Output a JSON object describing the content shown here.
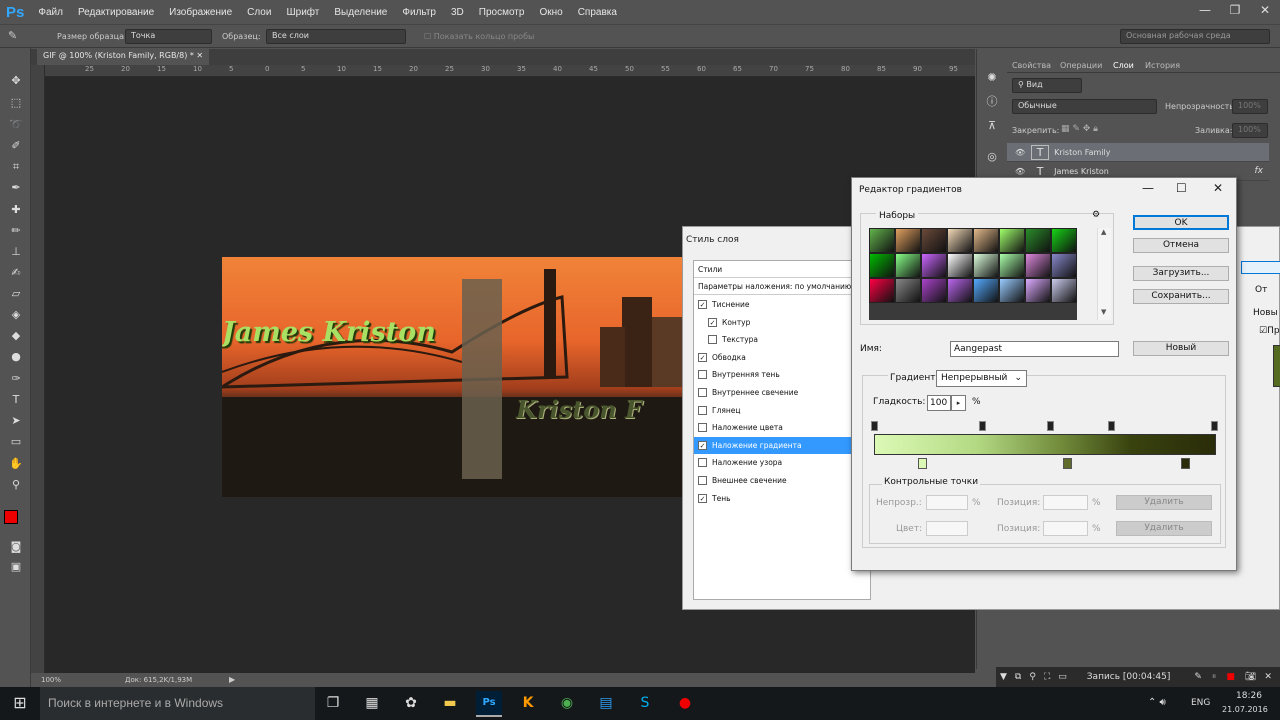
{
  "app": {
    "logo": "Ps"
  },
  "menu": [
    "Файл",
    "Редактирование",
    "Изображение",
    "Слои",
    "Шрифт",
    "Выделение",
    "Фильтр",
    "3D",
    "Просмотр",
    "Окно",
    "Справка"
  ],
  "options": {
    "sample_size_label": "Размер образца:",
    "sample_size_value": "Точка",
    "sample_label": "Образец:",
    "sample_value": "Все слои",
    "show_ring": "Показать кольцо пробы",
    "workspace": "Основная рабочая среда"
  },
  "document": {
    "tab": "GIF @ 100% (Kriston Family, RGB/8) *",
    "zoom": "100%",
    "doc_info": "Док: 615,2K/1,93M",
    "ruler_h": [
      "25",
      "20",
      "15",
      "10",
      "5",
      "0",
      "5",
      "10",
      "15",
      "20",
      "25",
      "30",
      "35",
      "40",
      "45",
      "50",
      "55",
      "60",
      "65",
      "70",
      "75",
      "80",
      "85",
      "90",
      "95",
      "10"
    ],
    "image_text1": "James Kriston",
    "image_text2": "Kriston F"
  },
  "panel": {
    "tabs": [
      "Свойства",
      "Операции",
      "Слои",
      "История"
    ],
    "kind": "Вид",
    "blend": "Обычные",
    "opacity_label": "Непрозрачность:",
    "opacity": "100%",
    "lock_label": "Закрепить:",
    "fill_label": "Заливка:",
    "fill": "100%",
    "layers": [
      "Kriston Family",
      "James Kriston"
    ]
  },
  "style_dialog": {
    "title": "Стиль слоя",
    "header": "Стили",
    "blend_defaults": "Параметры наложения: по умолчанию",
    "items": [
      {
        "label": "Тиснение",
        "checked": true,
        "indent": false,
        "selected": false
      },
      {
        "label": "Контур",
        "checked": true,
        "indent": true,
        "selected": false
      },
      {
        "label": "Текстура",
        "checked": false,
        "indent": true,
        "selected": false
      },
      {
        "label": "Обводка",
        "checked": true,
        "indent": false,
        "selected": false
      },
      {
        "label": "Внутренняя тень",
        "checked": false,
        "indent": false,
        "selected": false
      },
      {
        "label": "Внутреннее свечение",
        "checked": false,
        "indent": false,
        "selected": false
      },
      {
        "label": "Глянец",
        "checked": false,
        "indent": false,
        "selected": false
      },
      {
        "label": "Наложение цвета",
        "checked": false,
        "indent": false,
        "selected": false
      },
      {
        "label": "Наложение градиента",
        "checked": true,
        "indent": false,
        "selected": true
      },
      {
        "label": "Наложение узора",
        "checked": false,
        "indent": false,
        "selected": false
      },
      {
        "label": "Внешнее свечение",
        "checked": false,
        "indent": false,
        "selected": false
      },
      {
        "label": "Тень",
        "checked": true,
        "indent": false,
        "selected": false
      }
    ],
    "right_partial": [
      "От",
      "Новы",
      "Пр"
    ]
  },
  "gradient_editor": {
    "title": "Редактор градиентов",
    "presets_label": "Наборы",
    "ok": "OK",
    "cancel": "Отмена",
    "load": "Загрузить...",
    "save": "Сохранить...",
    "name_label": "Имя:",
    "name_value": "Aangepast",
    "new": "Новый",
    "gradient_label": "Градиент:",
    "gradient_type": "Непрерывный",
    "smoothness_label": "Гладкость:",
    "smoothness": "100",
    "percent": "%",
    "control_points": "Контрольные точки",
    "opacity_label": "Непрозр.:",
    "color_label": "Цвет:",
    "position_label": "Позиция:",
    "delete": "Удалить",
    "stop_colors": [
      "#dcfab6",
      "#5e6b2a",
      "#2a2c09"
    ],
    "preset_colors": [
      "#62b34c",
      "#e0a060",
      "#6b4a3a",
      "#f2d9b8",
      "#e2b98a",
      "#a0ff6c",
      "#2a8c2a",
      "#16d416",
      "#0b0",
      "#8f8",
      "#c6f",
      "#fff",
      "#dfd",
      "#afa",
      "#d8d",
      "#88c",
      "#f04",
      "#888",
      "#a4c",
      "#b6e",
      "#5af",
      "#9cf",
      "#daf",
      "#cce"
    ]
  },
  "recorder": {
    "text": "Запись [00:04:45]"
  },
  "taskbar": {
    "search": "Поиск в интернете и в Windows",
    "lang": "ENG",
    "time": "18:26",
    "date": "21.07.2016"
  }
}
